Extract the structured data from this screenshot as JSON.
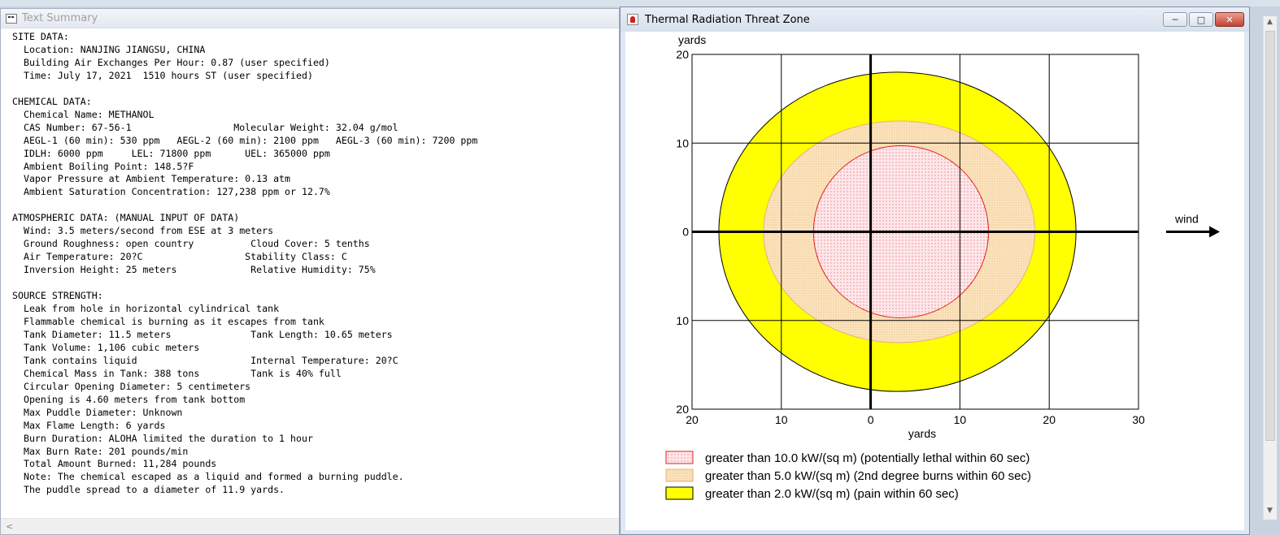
{
  "left_window": {
    "title": "Text Summary",
    "lines": [
      "SITE DATA:",
      "  Location: NANJING JIANGSU, CHINA",
      "  Building Air Exchanges Per Hour: 0.87 (user specified)",
      "  Time: July 17, 2021  1510 hours ST (user specified)",
      "",
      "CHEMICAL DATA:",
      "  Chemical Name: METHANOL",
      "  CAS Number: 67-56-1                  Molecular Weight: 32.04 g/mol",
      "  AEGL-1 (60 min): 530 ppm   AEGL-2 (60 min): 2100 ppm   AEGL-3 (60 min): 7200 ppm",
      "  IDLH: 6000 ppm     LEL: 71800 ppm      UEL: 365000 ppm",
      "  Ambient Boiling Point: 148.5?F",
      "  Vapor Pressure at Ambient Temperature: 0.13 atm",
      "  Ambient Saturation Concentration: 127,238 ppm or 12.7%",
      "",
      "ATMOSPHERIC DATA: (MANUAL INPUT OF DATA)",
      "  Wind: 3.5 meters/second from ESE at 3 meters",
      "  Ground Roughness: open country          Cloud Cover: 5 tenths",
      "  Air Temperature: 20?C                  Stability Class: C",
      "  Inversion Height: 25 meters             Relative Humidity: 75%",
      "",
      "SOURCE STRENGTH:",
      "  Leak from hole in horizontal cylindrical tank",
      "  Flammable chemical is burning as it escapes from tank",
      "  Tank Diameter: 11.5 meters              Tank Length: 10.65 meters",
      "  Tank Volume: 1,106 cubic meters",
      "  Tank contains liquid                    Internal Temperature: 20?C",
      "  Chemical Mass in Tank: 388 tons         Tank is 40% full",
      "  Circular Opening Diameter: 5 centimeters",
      "  Opening is 4.60 meters from tank bottom",
      "  Max Puddle Diameter: Unknown",
      "  Max Flame Length: 6 yards",
      "  Burn Duration: ALOHA limited the duration to 1 hour",
      "  Max Burn Rate: 201 pounds/min",
      "  Total Amount Burned: 11,284 pounds",
      "  Note: The chemical escaped as a liquid and formed a burning puddle.",
      "  The puddle spread to a diameter of 11.9 yards."
    ]
  },
  "right_window": {
    "title": "Thermal Radiation Threat Zone",
    "buttons": {
      "minimize": "─",
      "maximize": "□",
      "close": "✕"
    },
    "wind_label": "wind"
  },
  "chart_data": {
    "type": "threat-zone",
    "xlabel": "yards",
    "ylabel": "yards",
    "xlim": [
      -20,
      30
    ],
    "ylim": [
      -20,
      20
    ],
    "x_ticks": [
      -20,
      -10,
      0,
      10,
      20,
      30
    ],
    "x_tick_labels": [
      "20",
      "10",
      "0",
      "10",
      "20",
      "30"
    ],
    "y_ticks": [
      20,
      10,
      0,
      -10,
      -20
    ],
    "y_tick_labels": [
      "20",
      "10",
      "0",
      "10",
      "20"
    ],
    "grid": true,
    "zones": [
      {
        "label": "greater than 2.0 kW/(sq m) (pain within 60 sec)",
        "color": "#ffff00",
        "stroke": "#000000",
        "center_x": 3.0,
        "center_y": 0.0,
        "radius_x": 20.0,
        "radius_y": 18.0
      },
      {
        "label": "greater than 5.0 kW/(sq m) (2nd degree burns within 60 sec)",
        "color": "#fce4bf",
        "stroke": "#e3b57a",
        "center_x": 3.2,
        "center_y": 0.0,
        "radius_x": 15.2,
        "radius_y": 12.5
      },
      {
        "label": "greater than 10.0 kW/(sq m) (potentially lethal within 60 sec)",
        "color": "#fde7ea",
        "stroke": "#e02020",
        "center_x": 3.4,
        "center_y": 0.0,
        "radius_x": 9.8,
        "radius_y": 9.7
      }
    ],
    "legend_order": [
      2,
      1,
      0
    ],
    "legend_placement": "bottom"
  },
  "colors": {
    "lethal_fill": "#fde7ea",
    "lethal_dots": "#e02020",
    "burn_fill": "#fce4bf",
    "burn_dots": "#d9a25a",
    "pain_fill": "#ffff00"
  }
}
